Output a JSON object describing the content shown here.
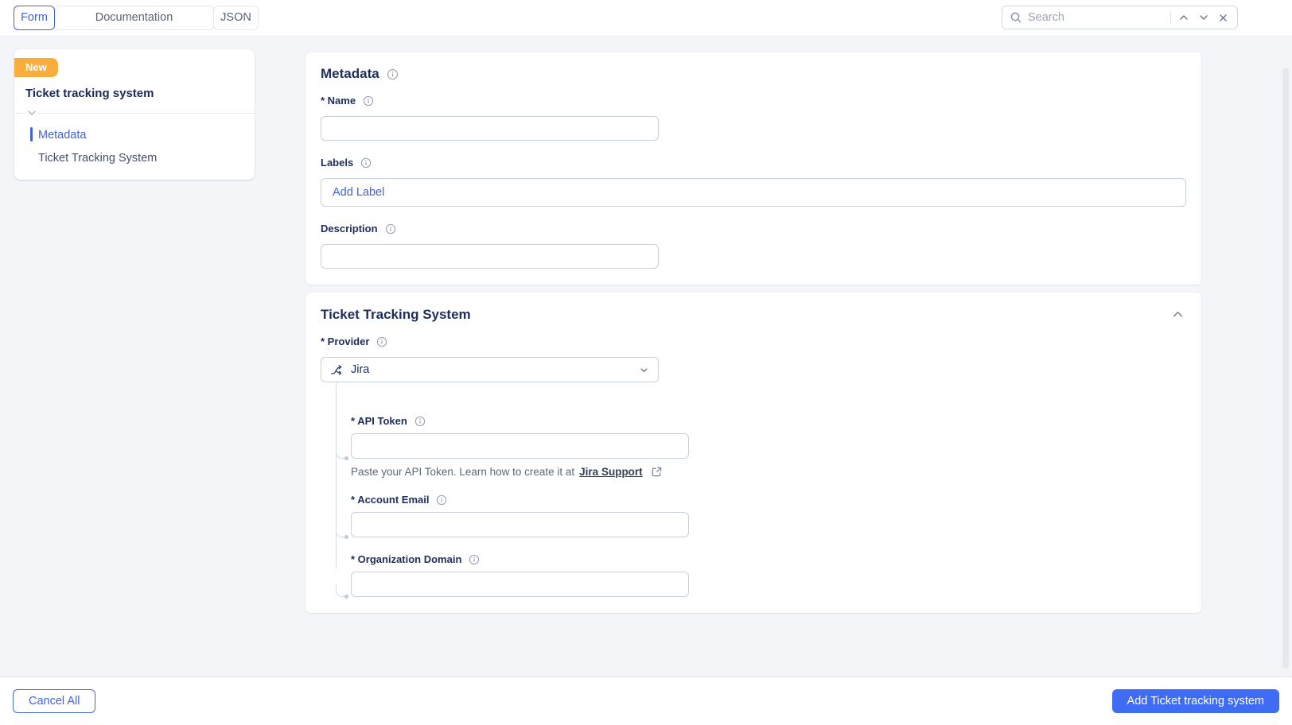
{
  "header": {
    "tabs": [
      {
        "label": "Form"
      },
      {
        "label": "Documentation"
      },
      {
        "label": "JSON"
      }
    ],
    "search": {
      "placeholder": "Search",
      "value": ""
    }
  },
  "sidebar": {
    "badge": "New",
    "title": "Ticket tracking system",
    "nav": [
      {
        "label": "Metadata"
      },
      {
        "label": "Ticket Tracking System"
      }
    ]
  },
  "metadata_card": {
    "title": "Metadata",
    "name_label": "* Name",
    "name_value": "",
    "labels_label": "Labels",
    "add_label_text": "Add Label",
    "description_label": "Description",
    "description_value": ""
  },
  "ticket_card": {
    "title": "Ticket Tracking System",
    "provider_label": "* Provider",
    "provider_value": "Jira",
    "api_token_label": "* API Token",
    "api_token_value": "",
    "api_token_helper_text": "Paste your API Token. Learn how to create it at",
    "api_token_helper_link": "Jira Support",
    "account_email_label": "* Account Email",
    "account_email_value": "",
    "org_domain_label": "* Organization Domain",
    "org_domain_value": ""
  },
  "footer": {
    "cancel_label": "Cancel All",
    "submit_label": "Add Ticket tracking system"
  },
  "colors": {
    "accent_blue": "#3E63DD",
    "primary_button_blue": "#3F6CF4",
    "badge_orange": "#F9AD3D",
    "heading_navy": "#1D2D5C",
    "content_background": "#F4F5F8"
  }
}
